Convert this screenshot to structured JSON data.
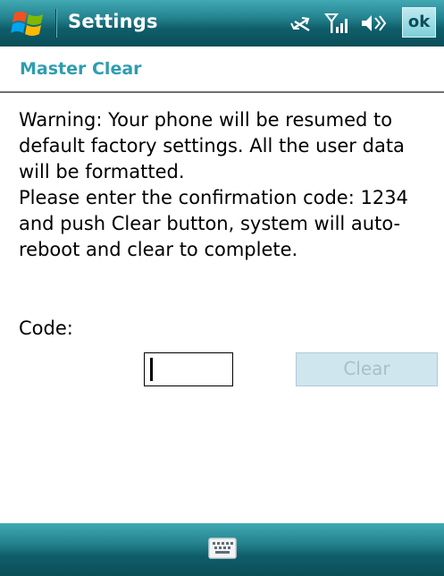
{
  "titlebar": {
    "app_title": "Settings",
    "icons": [
      "windows-start-icon",
      "connectivity-icon",
      "signal-icon",
      "volume-icon"
    ],
    "ok_label": "ok"
  },
  "header": {
    "title": "Master Clear"
  },
  "content": {
    "warning_lines": [
      "Warning: Your phone will be resumed to",
      "default factory settings. All the user data",
      "will be formatted.",
      "Please enter the confirmation code: 1234",
      "and push Clear button, system will auto-",
      "reboot and clear to complete."
    ],
    "code_label": "Code:",
    "code_value": "",
    "clear_label": "Clear"
  },
  "bottombar": {
    "icon": "keyboard-icon"
  },
  "colors": {
    "accent": "#2e9db0",
    "bar_dark": "#0a4e59",
    "bar_light": "#41a9b3",
    "disabled_button": "#cfe6ee"
  }
}
